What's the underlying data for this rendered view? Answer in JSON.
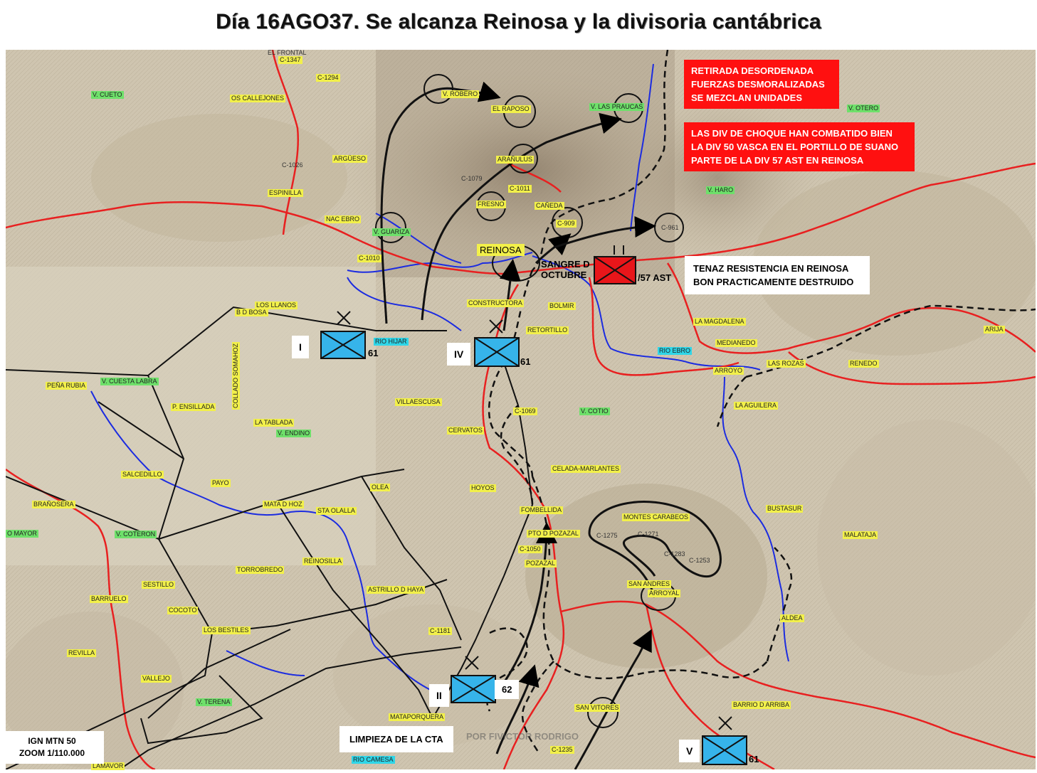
{
  "title": "Día 16AGO37. Se alcanza Reinosa y la divisoria cantábrica",
  "info_boxes": {
    "retirada": [
      "RETIRADA DESORDENADA",
      "FUERZAS DESMORALIZADAS",
      "SE MEZCLAN UNIDADES"
    ],
    "choque": [
      "LAS DIV DE CHOQUE HAN COMBATIDO BIEN",
      "LA DIV 50 VASCA EN EL PORTILLO DE SUANO",
      "PARTE DE LA DIV 57 AST EN REINOSA"
    ],
    "resistencia": [
      "TENAZ RESISTENCIA EN REINOSA",
      "BON PRACTICAMENTE DESTRUIDO"
    ],
    "limpieza": "LIMPIEZA DE LA CTA",
    "scale": [
      "IGN MTN 50",
      "ZOOM 1/110.000"
    ]
  },
  "units": {
    "I": {
      "label": "I",
      "number": "61"
    },
    "IV": {
      "label": "IV",
      "number": "61"
    },
    "II": {
      "label": "II",
      "number": "62"
    },
    "V": {
      "label": "V",
      "number": "61"
    },
    "enemy": {
      "left": "SANGRE D OCTUBRE",
      "right": "/57 AST"
    }
  },
  "reinosa_label": "REINOSA",
  "watermark": "POR FIVICTOR RODRIGO",
  "places": {
    "p1": "EL FRONTAL",
    "p2": "C-1347",
    "p3": "C-1294",
    "p4": "V. CUETO",
    "p5": "OS CALLEJONES",
    "p6": "V. ROBERO",
    "p7": "EL RAPOSO",
    "p8": "V. LAS PRAUCAS",
    "p9": "V. OTERO",
    "p10": "ARGÜESO",
    "p11": "C-1026",
    "p12": "ARAÑULUS",
    "p13": "C-1079",
    "p14": "C-1011",
    "p15": "ESPINILLA",
    "p16": "FRESNO",
    "p17": "CAÑEDA",
    "p18": "V. HARO",
    "p19": "NAC EBRO",
    "p20": "V. GUARIZA",
    "p21": "C-909",
    "p22": "C-961",
    "p23": "C-1010",
    "p24": "LOS LLANOS",
    "p25": "B D BOSA",
    "p26": "CONSTRUCTORA",
    "p27": "BOLMIR",
    "p28": "LA MAGDALENA",
    "p29": "RIO HIJAR",
    "p30": "RETORTILLO",
    "p31": "MEDIANEDO",
    "p32": "ARIJA",
    "p33": "RIO EBRO",
    "p34": "ARROYO",
    "p35": "LAS ROZAS",
    "p36": "RENEDO",
    "p37": "PEÑA RUBIA",
    "p38": "V. CUESTA LABRA",
    "p39": "P. ENSILLADA",
    "p40": "COLLADO SOMAHOZ",
    "p41": "LA TABLADA",
    "p42": "V. ENDINO",
    "p43": "VILLAESCUSA",
    "p44": "C-1069",
    "p45": "V. COTIO",
    "p46": "LA AGUILERA",
    "p47": "CERVATOS",
    "p48": "SALCEDILLO",
    "p49": "CELADA-MARLANTES",
    "p50": "PAYO",
    "p51": "OLEA",
    "p52": "HOYOS",
    "p53": "BRAÑOSERA",
    "p54": "MATA D HOZ",
    "p55": "STA OLALLA",
    "p56": "FOMBELLIDA",
    "p57": "MONTES CARABEOS",
    "p58": "BUSTASUR",
    "p59": "O MAYOR",
    "p60": "V. COTERON",
    "p61": "PTO D POZAZAL",
    "p62": "C-1275",
    "p63": "C-1271",
    "p64": "MALATAJA",
    "p65": "C-1050",
    "p66": "C-1283",
    "p67": "C-1253",
    "p68": "REINOSILLA",
    "p69": "POZAZAL",
    "p70": "TORROBREDO",
    "p71": "SESTILLO",
    "p72": "ASTRILLO D HAYA",
    "p73": "SAN ANDRES",
    "p74": "ARROYAL",
    "p75": "BARRUELO",
    "p76": "COCOTO",
    "p77": "ALDEA",
    "p78": "LOS BESTILES",
    "p79": "C-1181",
    "p80": "REVILLA",
    "p81": "VALLEJO",
    "p82": "V. TERENA",
    "p83": "SAN VITORES",
    "p84": "BARRIO D ARRIBA",
    "p85": "MATAPORQUERA",
    "p86": "C-1235",
    "p87": "RIO CAMESA",
    "p88": "LAMAVOR"
  },
  "colors": {
    "red_box": "#ff1010",
    "unit_friendly": "#36b4ea",
    "unit_enemy": "#e8161a",
    "road": "#e82020",
    "river": "#1c2ce0",
    "label_yellow": "#f2f04a",
    "label_green": "#6ee06a",
    "label_cyan": "#2fd6e8"
  }
}
